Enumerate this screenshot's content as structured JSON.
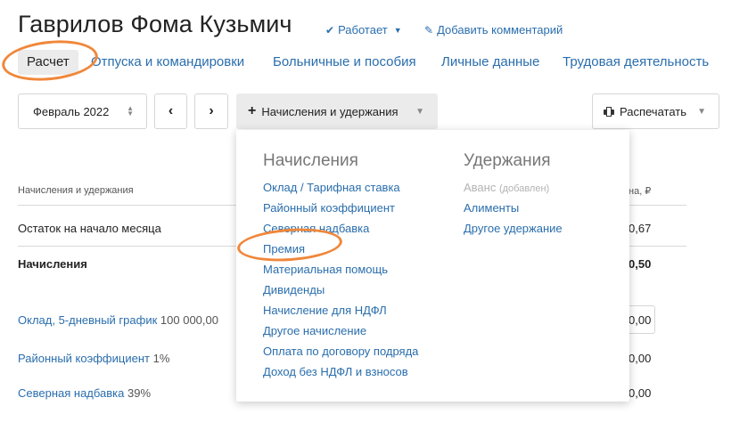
{
  "header": {
    "employee_name": "Гаврилов Фома Кузьмич",
    "status_label": "Работает",
    "add_comment_label": "Добавить комментарий"
  },
  "tabs": [
    {
      "label": "Расчет",
      "active": true
    },
    {
      "label": "Отпуска и командировки",
      "active": false
    },
    {
      "label": "Больничные и пособия",
      "active": false
    },
    {
      "label": "Личные данные",
      "active": false
    },
    {
      "label": "Трудовая деятельность",
      "active": false
    }
  ],
  "toolbar": {
    "period": "Февраль 2022",
    "prev_label": "‹",
    "next_label": "›",
    "add_label": "Начисления и удержания",
    "print_label": "Распечатать"
  },
  "table": {
    "col_left": "Начисления и удержания",
    "col_right": "на, ₽",
    "rows": [
      {
        "label": "Остаток на начало месяца",
        "value": "0,67"
      },
      {
        "label": "Начисления",
        "value": "0,50"
      },
      {
        "label": "Оклад, 5-дневный график",
        "extra": "100 000,00",
        "value": "0,00"
      },
      {
        "label": "Районный коэффициент",
        "extra": "1%",
        "value": "0,00"
      },
      {
        "label": "Северная надбавка",
        "extra": "39%",
        "value": "0,00"
      }
    ]
  },
  "dropdown": {
    "accruals": {
      "title": "Начисления",
      "items": [
        "Оклад / Тарифная ставка",
        "Районный коэффициент",
        "Северная надбавка",
        "Премия",
        "Материальная помощь",
        "Дивиденды",
        "Начисление для НДФЛ",
        "Другое начисление",
        "Оплата по договору подряда",
        "Доход без НДФЛ и взносов"
      ]
    },
    "deductions": {
      "title": "Удержания",
      "advance": "Аванс",
      "advance_note": "(добавлен)",
      "items": [
        "Алименты",
        "Другое удержание"
      ]
    }
  },
  "colors": {
    "link": "#2a6ead",
    "highlight": "#f0873a"
  }
}
